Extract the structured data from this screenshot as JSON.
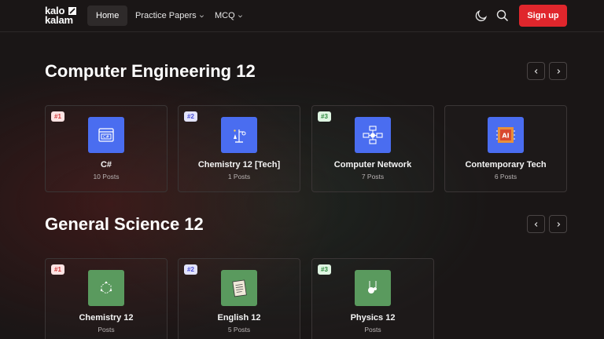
{
  "brand": {
    "line1": "kalo",
    "line2": "kalam"
  },
  "nav": {
    "home": "Home",
    "practice_papers": "Practice Papers",
    "mcq": "MCQ",
    "signup": "Sign up"
  },
  "icons": {
    "theme": "moon-icon",
    "search": "search-icon",
    "prev": "chevron-left-icon",
    "next": "chevron-right-icon"
  },
  "colors": {
    "accent": "#e0262c",
    "tile_blue": "#4a6df0",
    "tile_green": "#5a9a5e"
  },
  "sections": [
    {
      "title": "Computer Engineering 12",
      "cards": [
        {
          "rank": "#1",
          "title": "C#",
          "posts": "10 Posts",
          "icon": "csharp-window-icon"
        },
        {
          "rank": "#2",
          "title": "Chemistry 12 [Tech]",
          "posts": "1 Posts",
          "icon": "lab-stand-icon"
        },
        {
          "rank": "#3",
          "title": "Computer Network",
          "posts": "7 Posts",
          "icon": "network-icon"
        },
        {
          "rank": "",
          "title": "Contemporary Tech",
          "posts": "6 Posts",
          "icon": "ai-chip-icon"
        }
      ]
    },
    {
      "title": "General Science 12",
      "cards": [
        {
          "rank": "#1",
          "title": "Chemistry 12",
          "posts": "Posts",
          "icon": "molecule-icon"
        },
        {
          "rank": "#2",
          "title": "English 12",
          "posts": "5 Posts",
          "icon": "notebook-icon"
        },
        {
          "rank": "#3",
          "title": "Physics 12",
          "posts": "Posts",
          "icon": "pendulum-icon"
        }
      ]
    }
  ]
}
